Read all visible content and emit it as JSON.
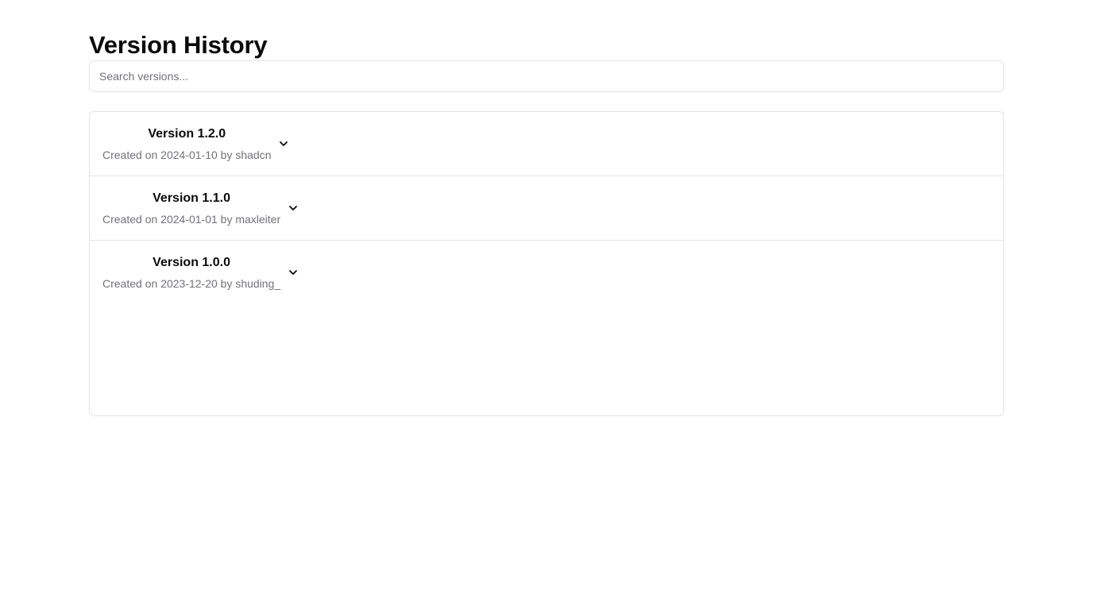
{
  "page": {
    "title": "Version History"
  },
  "search": {
    "placeholder": "Search versions..."
  },
  "versions": [
    {
      "title": "Version 1.2.0",
      "meta": "Created on 2024-01-10 by shadcn"
    },
    {
      "title": "Version 1.1.0",
      "meta": "Created on 2024-01-01 by maxleiter"
    },
    {
      "title": "Version 1.0.0",
      "meta": "Created on 2023-12-20 by shuding_"
    }
  ],
  "icons": {
    "expand": "chevron-down-icon"
  },
  "colors": {
    "text": "#0a0a0a",
    "muted": "#71717a",
    "border": "#e4e4e7",
    "background": "#ffffff"
  }
}
